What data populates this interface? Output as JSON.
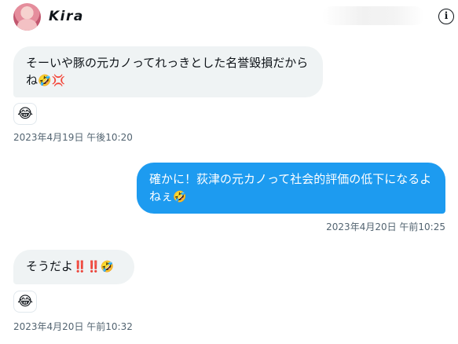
{
  "header": {
    "username": "Kira",
    "info_glyph": "i"
  },
  "messages": [
    {
      "line1": "そーいや豚の元カノってれっきとした名誉毀損だから",
      "line2": "ね",
      "emoji": "🤣💢",
      "reaction": "😂",
      "timestamp": "2023年4月19日 午後10:20"
    },
    {
      "line1": "確かに！荻津の元カノって社会的評価の低下になるよ",
      "line2": "ねぇ",
      "emoji": "🤣",
      "timestamp": "2023年4月20日 午前10:25"
    },
    {
      "text": "そうだよ",
      "emoji": "‼️‼️🤣",
      "reaction": "😂",
      "timestamp": "2023年4月20日 午前10:32"
    }
  ],
  "icons": {
    "info": "info-circle-icon",
    "avatar": "avatar"
  },
  "colors": {
    "sent_bubble": "#1d9bf0",
    "received_bubble": "#eff3f4",
    "timestamp": "#536471"
  }
}
